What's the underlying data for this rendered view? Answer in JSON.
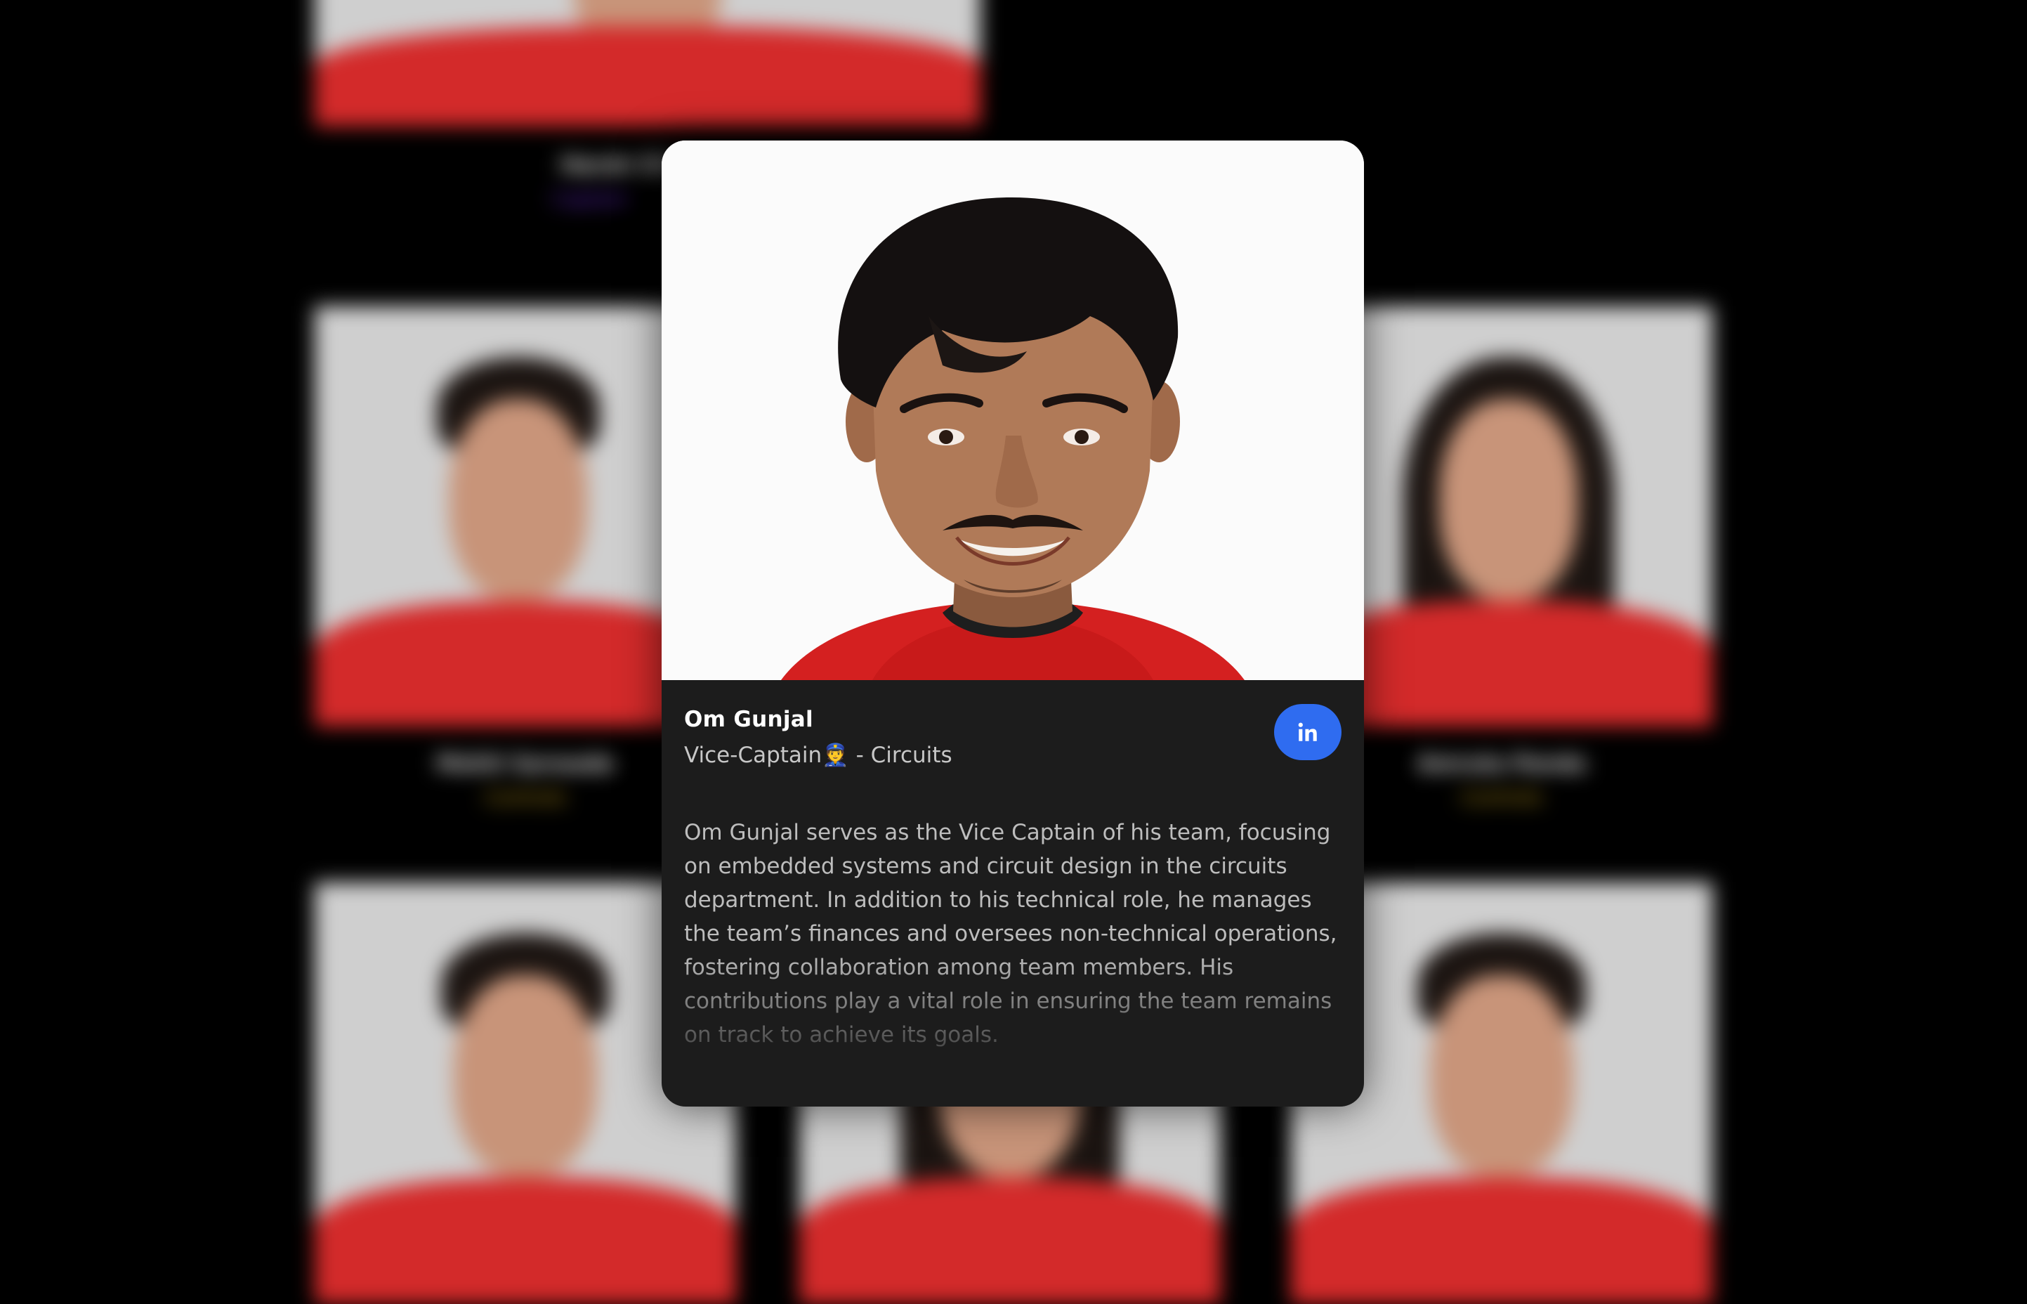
{
  "background": {
    "members": [
      {
        "name": "Harsh Chi",
        "role": "Captain",
        "role_color": "purple"
      },
      {
        "name": "Mohit Sarwade",
        "role": "Controls",
        "role_color": "gold"
      },
      {
        "name": "Amruta Panda",
        "role": "Controls",
        "role_color": "gold"
      }
    ]
  },
  "modal": {
    "name": "Om Gunjal",
    "role": "Vice-Captain👮 - Circuits",
    "linkedin_icon": "linkedin-icon",
    "bio": "Om Gunjal serves as the Vice Captain of his team, focusing on embedded systems and circuit design in the circuits department. In addition to his technical role, he manages the team’s finances and oversees non-technical operations, fostering collaboration among team members. His contributions play a vital role in ensuring the team remains on track to achieve its goals."
  },
  "colors": {
    "modal_bg": "#1c1c1c",
    "linkedin_button": "#2f6cf0",
    "shirt_red": "#d32a2a",
    "captain_role": "#6a2bd8",
    "controls_role": "#c9a21a"
  }
}
